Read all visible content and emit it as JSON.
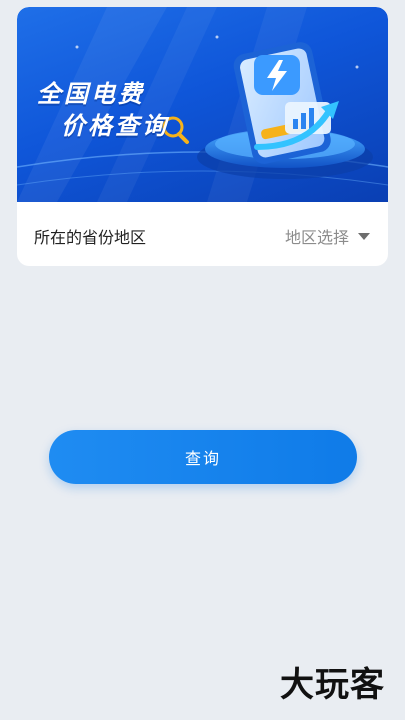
{
  "banner": {
    "title_line1": "全国电费",
    "title_line2": "价格查询"
  },
  "region": {
    "label": "所在的省份地区",
    "placeholder": "地区选择"
  },
  "actions": {
    "query_label": "查询"
  },
  "watermark": "大玩客",
  "colors": {
    "background": "#e9edf2",
    "banner_blue": "#0f56d9",
    "button_blue": "#1a87f0"
  }
}
